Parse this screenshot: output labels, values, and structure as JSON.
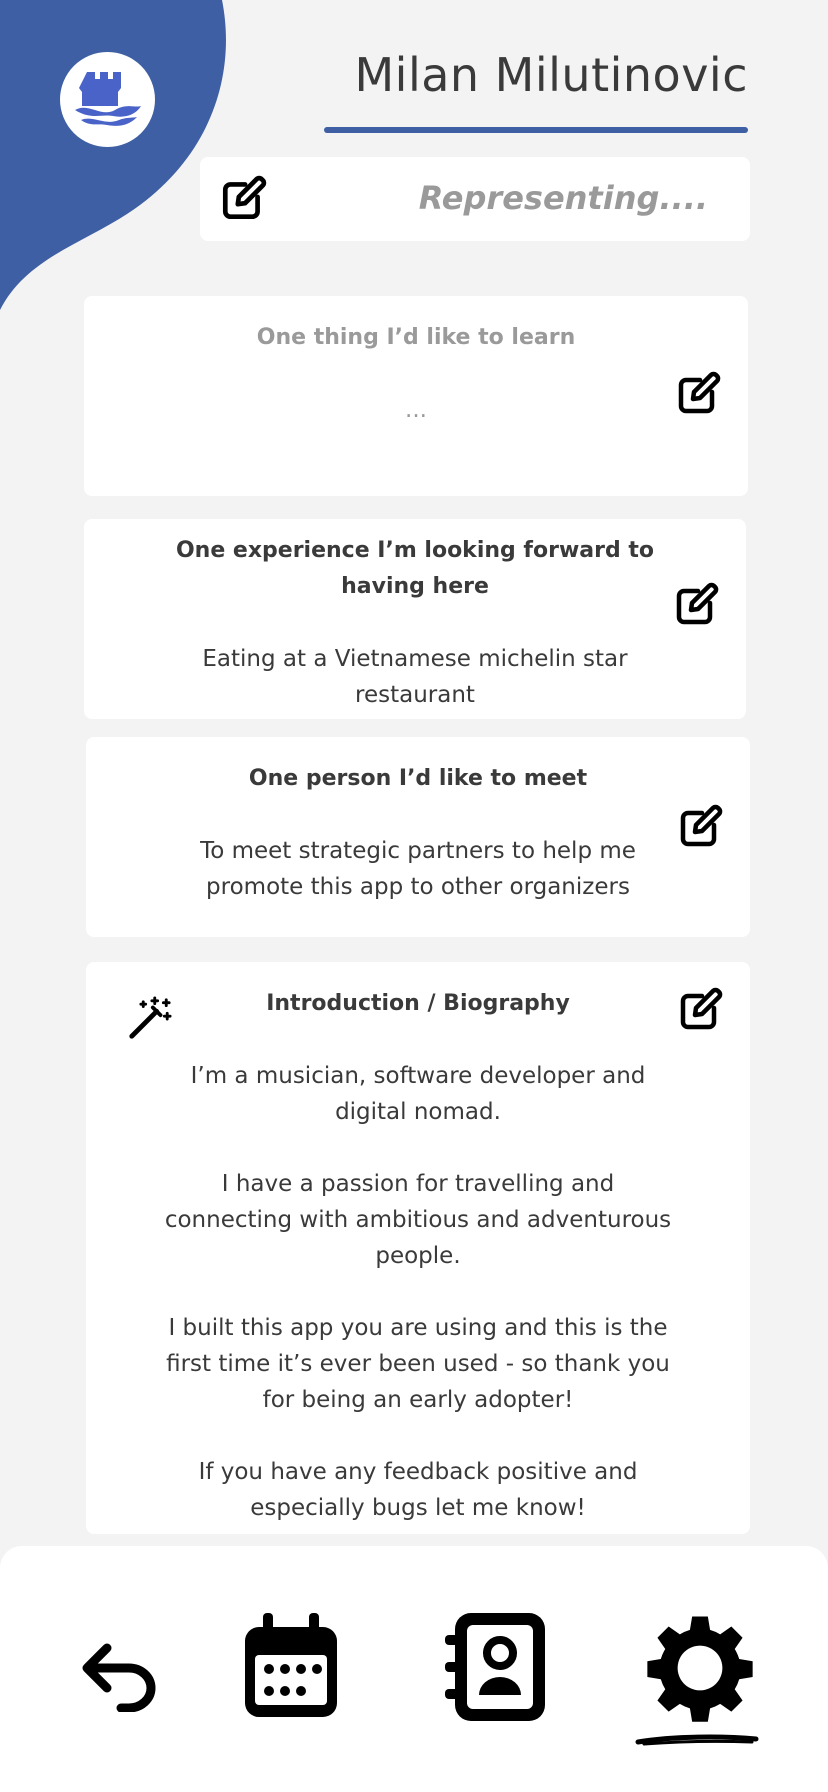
{
  "colors": {
    "accent": "#3e5fa3",
    "background": "#f3f3f3",
    "card": "#ffffff",
    "muted": "#9a9a9a"
  },
  "header": {
    "logo_icon": "castle-waves-logo-icon",
    "name": "Milan Milutinovic"
  },
  "representing": {
    "placeholder": "Representing....",
    "icon": "edit-icon"
  },
  "cards": {
    "learn": {
      "title": "One thing I’d like to learn",
      "body": "..."
    },
    "experience": {
      "title": "One experience I’m looking forward to having here",
      "body": "Eating at a Vietnamese michelin star restaurant"
    },
    "person": {
      "title": "One person I’d like to meet",
      "body": "To meet strategic partners to help me promote this app to other organizers"
    },
    "bio": {
      "title": "Introduction / Biography",
      "icon": "magic-wand-icon",
      "paragraphs": [
        "I’m a musician, software developer and digital nomad.",
        "I have a passion for travelling and connecting with ambitious and adventurous people.",
        "I built this app you are using and this is the first time it’s ever been used - so thank you for being an early adopter!",
        "If you have any feedback positive and especially bugs let me know!"
      ]
    }
  },
  "nav": {
    "items": [
      {
        "icon": "back-arrow-icon"
      },
      {
        "icon": "calendar-icon"
      },
      {
        "icon": "contacts-book-icon"
      },
      {
        "icon": "settings-gear-icon",
        "active": true
      }
    ]
  }
}
